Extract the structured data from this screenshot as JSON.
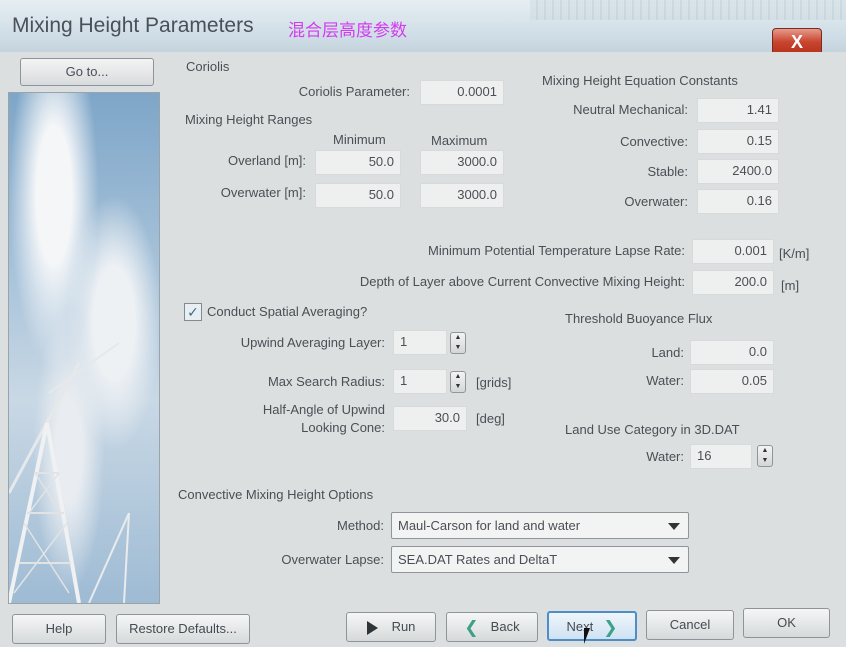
{
  "window": {
    "title": "Mixing Height Parameters",
    "subtitle_cn": "混合层高度参数",
    "close_label": "X"
  },
  "left_panel": {
    "goto_label": "Go to..."
  },
  "coriolis": {
    "group_title": "Coriolis",
    "param_label": "Coriolis Parameter:",
    "param_value": "0.0001"
  },
  "ranges": {
    "group_title": "Mixing Height Ranges",
    "min_header": "Minimum",
    "max_header": "Maximum",
    "overland_label": "Overland [m]:",
    "overland_min": "50.0",
    "overland_max": "3000.0",
    "overwater_label": "Overwater [m]:",
    "overwater_min": "50.0",
    "overwater_max": "3000.0"
  },
  "equation_constants": {
    "group_title": "Mixing Height Equation Constants",
    "neutral_label": "Neutral Mechanical:",
    "neutral_value": "1.41",
    "convective_label": "Convective:",
    "convective_value": "0.15",
    "stable_label": "Stable:",
    "stable_value": "2400.0",
    "overwater_label": "Overwater:",
    "overwater_value": "0.16"
  },
  "lapse": {
    "min_label": "Minimum Potential Temperature Lapse Rate:",
    "min_value": "0.001",
    "min_unit": "[K/m]",
    "depth_label": "Depth of Layer above Current Convective Mixing Height:",
    "depth_value": "200.0",
    "depth_unit": "[m]"
  },
  "spatial": {
    "checkbox_label": "Conduct Spatial Averaging?",
    "checked": true,
    "upwind_label": "Upwind Averaging Layer:",
    "upwind_value": "1",
    "radius_label": "Max Search Radius:",
    "radius_value": "1",
    "radius_unit": "[grids]",
    "halfangle_label_1": "Half-Angle of Upwind",
    "halfangle_label_2": "Looking Cone:",
    "halfangle_value": "30.0",
    "halfangle_unit": "[deg]"
  },
  "buoyancy": {
    "group_title": "Threshold Buoyance Flux",
    "land_label": "Land:",
    "land_value": "0.0",
    "water_label": "Water:",
    "water_value": "0.05"
  },
  "landuse": {
    "group_title": "Land Use Category in 3D.DAT",
    "water_label": "Water:",
    "water_value": "16"
  },
  "convective_options": {
    "group_title": "Convective Mixing Height Options",
    "method_label": "Method:",
    "method_value": "Maul-Carson for land and water",
    "lapse_label": "Overwater Lapse:",
    "lapse_value": "SEA.DAT Rates and DeltaT"
  },
  "buttons": {
    "help": "Help",
    "restore": "Restore Defaults...",
    "run": "Run",
    "back": "Back",
    "next": "Next",
    "cancel": "Cancel",
    "ok": "OK"
  }
}
